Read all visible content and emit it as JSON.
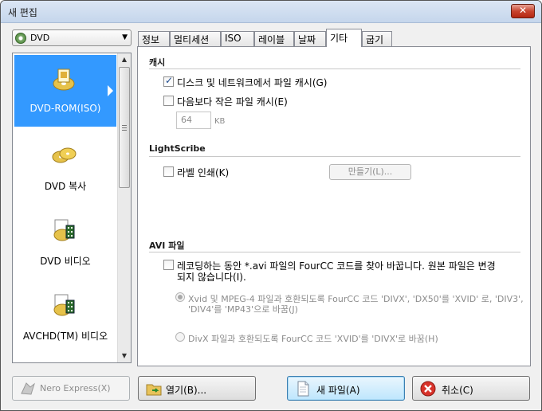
{
  "window": {
    "title": "새 편집",
    "close_label": "✕"
  },
  "source_combo": {
    "value": "DVD",
    "icon": "dvd-disc-icon"
  },
  "sidebar": {
    "items": [
      {
        "label": "DVD-ROM(ISO)",
        "icon": "dvd-rom-icon",
        "selected": true
      },
      {
        "label": "DVD 복사",
        "icon": "dvd-copy-icon"
      },
      {
        "label": "DVD 비디오",
        "icon": "dvd-video-icon"
      },
      {
        "label": "AVCHD(TM) 비디오",
        "icon": "avchd-video-icon"
      }
    ]
  },
  "tabs": [
    "정보",
    "멀티세션",
    "ISO",
    "레이블",
    "날짜",
    "기타",
    "굽기"
  ],
  "active_tab": "기타",
  "cache": {
    "title": "캐시",
    "cache_files_label": "디스크 및 네트워크에서 파일 캐시(G)",
    "cache_files_checked": true,
    "cache_small_label": "다음보다 작은 파일 캐시(E)",
    "cache_small_checked": false,
    "size_value": "64",
    "size_unit": "KB"
  },
  "lightscribe": {
    "title": "LightScribe",
    "label_print_label": "라벨 인쇄(K)",
    "create_button": "만들기(L)..."
  },
  "avi": {
    "title": "AVI 파일",
    "fourcc_label_line1": "레코딩하는 동안 *.avi 파일의 FourCC 코드를 찾아 바꿉니다. 원본 파일은 변경",
    "fourcc_label_line2": "되지 않습니다(I).",
    "xvid_option_line1": "Xvid 및 MPEG-4 파일과 호환되도록 FourCC 코드 'DIVX', 'DX50'를 'XVID' 로, 'DIV3',",
    "xvid_option_line2": "'DIV4'를 'MP43'으로 바꿈(J)",
    "divx_option": "DivX 파일과 호환되도록 FourCC 코드 'XVID'를 'DIVX'로 바꿈(H)"
  },
  "buttons": {
    "nero_express": "Nero Express(X)",
    "open": "열기(B)...",
    "new_file": "새 파일(A)",
    "cancel": "취소(C)"
  }
}
